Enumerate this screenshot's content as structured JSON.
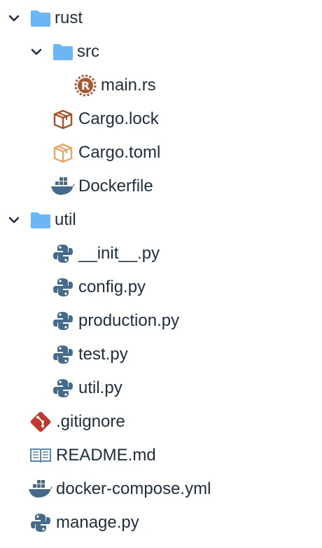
{
  "tree": {
    "items": [
      {
        "label": "rust",
        "kind": "folder",
        "expanded": true,
        "icon": "folder-icon"
      },
      {
        "label": "src",
        "kind": "folder",
        "expanded": true,
        "icon": "folder-icon"
      },
      {
        "label": "main.rs",
        "kind": "file",
        "icon": "rust-icon"
      },
      {
        "label": "Cargo.lock",
        "kind": "file",
        "icon": "package-icon"
      },
      {
        "label": "Cargo.toml",
        "kind": "file",
        "icon": "package-icon"
      },
      {
        "label": "Dockerfile",
        "kind": "file",
        "icon": "docker-icon"
      },
      {
        "label": "util",
        "kind": "folder",
        "expanded": true,
        "icon": "folder-icon"
      },
      {
        "label": "__init__.py",
        "kind": "file",
        "icon": "python-icon"
      },
      {
        "label": "config.py",
        "kind": "file",
        "icon": "python-icon"
      },
      {
        "label": "production.py",
        "kind": "file",
        "icon": "python-icon"
      },
      {
        "label": "test.py",
        "kind": "file",
        "icon": "python-icon"
      },
      {
        "label": "util.py",
        "kind": "file",
        "icon": "python-icon"
      },
      {
        "label": ".gitignore",
        "kind": "file",
        "icon": "git-icon"
      },
      {
        "label": "README.md",
        "kind": "file",
        "icon": "book-icon"
      },
      {
        "label": "docker-compose.yml",
        "kind": "file",
        "icon": "docker-icon"
      },
      {
        "label": "manage.py",
        "kind": "file",
        "icon": "python-icon"
      }
    ]
  },
  "colors": {
    "folder": "#6cb6f5",
    "chevron": "#1f2d3d",
    "rust": "#a45a36",
    "package_dark": "#a4532a",
    "package_light": "#e5a56c",
    "docker": "#466b8a",
    "python": "#466b8a",
    "git": "#bf3a2b",
    "book": "#5c8aa6",
    "text": "#1f2d3d"
  }
}
